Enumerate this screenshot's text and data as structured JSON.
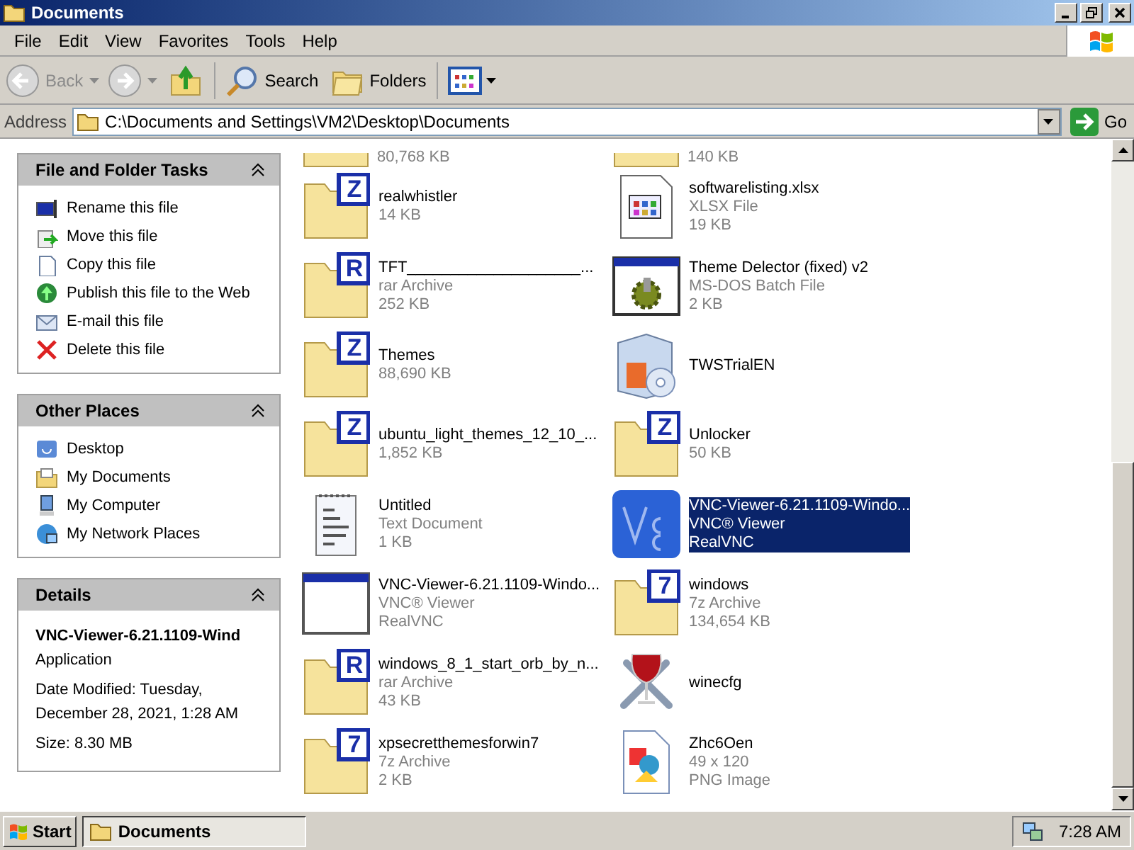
{
  "window": {
    "title": "Documents"
  },
  "menu": [
    "File",
    "Edit",
    "View",
    "Favorites",
    "Tools",
    "Help"
  ],
  "toolbar": [
    {
      "kind": "back",
      "label": "Back",
      "disabled": true
    },
    {
      "kind": "forward",
      "disabled": true
    },
    {
      "kind": "up",
      "disabled": false
    },
    {
      "kind": "search",
      "label": "Search",
      "disabled": false
    },
    {
      "kind": "folders",
      "label": "Folders",
      "disabled": false
    },
    {
      "kind": "views"
    }
  ],
  "address": {
    "label": "Address",
    "value": "C:\\Documents and Settings\\VM2\\Desktop\\Documents",
    "go": "Go"
  },
  "panels": [
    {
      "title": "File and Folder Tasks",
      "expanded": true,
      "items": [
        {
          "kind": "rename",
          "label": "Rename this file"
        },
        {
          "kind": "move",
          "label": "Move this file"
        },
        {
          "kind": "copy",
          "label": "Copy this file"
        },
        {
          "kind": "publish",
          "label": "Publish this file to the Web"
        },
        {
          "kind": "email",
          "label": "E-mail this file"
        },
        {
          "kind": "delete",
          "label": "Delete this file"
        }
      ]
    },
    {
      "title": "Other Places",
      "expanded": true,
      "items": [
        {
          "kind": "desktop",
          "label": "Desktop"
        },
        {
          "kind": "documents",
          "label": "My Documents"
        },
        {
          "kind": "computer",
          "label": "My Computer"
        },
        {
          "kind": "network",
          "label": "My Network Places"
        }
      ]
    },
    {
      "title": "Details",
      "expanded": true,
      "details": {
        "name": "VNC-Viewer-6.21.1109-Wind",
        "type": "Application",
        "modified": "Date Modified: Tuesday, December 28, 2021, 1:28 AM",
        "size": "Size: 8.30 MB"
      }
    }
  ],
  "files": [
    {
      "kind": "archive",
      "clipped": true,
      "lines": [
        "80,768 KB"
      ],
      "selected": false
    },
    {
      "kind": "archive",
      "clipped": true,
      "lines": [
        "140 KB"
      ],
      "selected": false
    },
    {
      "kind": "archive",
      "badge": "Z",
      "lines": [
        "realwhistler",
        "14 KB"
      ],
      "selected": false
    },
    {
      "kind": "spreadsheet",
      "lines": [
        "softwarelisting.xlsx",
        "XLSX File",
        "19 KB"
      ],
      "selected": false
    },
    {
      "kind": "archive",
      "badge": "R",
      "lines": [
        "TFT____________________...",
        "rar Archive",
        "252 KB"
      ],
      "selected": false
    },
    {
      "kind": "batch",
      "lines": [
        "Theme Delector (fixed) v2",
        "MS-DOS Batch File",
        "2 KB"
      ],
      "selected": false
    },
    {
      "kind": "archive",
      "badge": "Z",
      "lines": [
        "Themes",
        "88,690 KB"
      ],
      "selected": false
    },
    {
      "kind": "installer",
      "lines": [
        "TWSTrialEN"
      ],
      "selected": false
    },
    {
      "kind": "archive",
      "badge": "Z",
      "lines": [
        "ubuntu_light_themes_12_10_...",
        "1,852 KB"
      ],
      "selected": false
    },
    {
      "kind": "archive",
      "badge": "Z",
      "lines": [
        "Unlocker",
        "50 KB"
      ],
      "selected": false
    },
    {
      "kind": "text",
      "lines": [
        "Untitled",
        "Text Document",
        "1 KB"
      ],
      "selected": false
    },
    {
      "kind": "vnc",
      "lines": [
        "VNC-Viewer-6.21.1109-Windo...",
        "VNC® Viewer",
        "RealVNC"
      ],
      "selected": true
    },
    {
      "kind": "app",
      "lines": [
        "VNC-Viewer-6.21.1109-Windo...",
        "VNC® Viewer",
        "RealVNC"
      ],
      "selected": false
    },
    {
      "kind": "archive",
      "badge": "7",
      "lines": [
        "windows",
        "7z Archive",
        "134,654 KB"
      ],
      "selected": false
    },
    {
      "kind": "archive",
      "badge": "R",
      "lines": [
        "windows_8_1_start_orb_by_n...",
        "rar Archive",
        "43 KB"
      ],
      "selected": false
    },
    {
      "kind": "wine",
      "lines": [
        "winecfg"
      ],
      "selected": false
    },
    {
      "kind": "archive",
      "badge": "7",
      "lines": [
        "xpsecretthemesforwin7",
        "7z Archive",
        "2 KB"
      ],
      "selected": false
    },
    {
      "kind": "image",
      "lines": [
        "Zhc6Oen",
        "49 x 120",
        "PNG Image"
      ],
      "selected": false
    }
  ],
  "taskbar": {
    "start": "Start",
    "tasks": [
      {
        "label": "Documents",
        "selected": true
      }
    ],
    "clock": "7:28 AM"
  }
}
